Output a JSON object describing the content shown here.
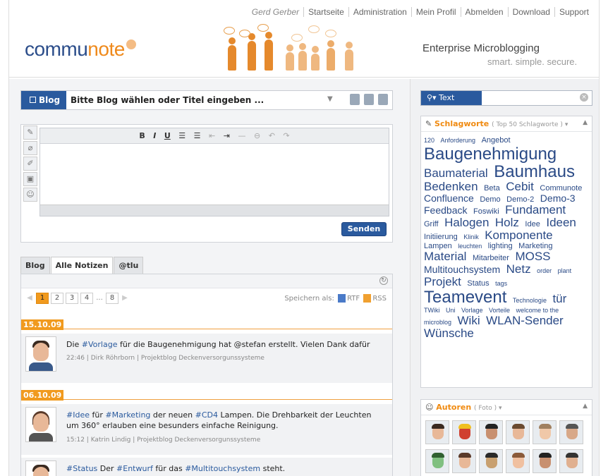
{
  "topnav": {
    "user": "Gerd Gerber",
    "links": [
      "Startseite",
      "Administration",
      "Mein Profil",
      "Abmelden",
      "Download",
      "Support"
    ]
  },
  "header": {
    "logo_a": "commu",
    "logo_b": "note",
    "tagline": "Enterprise Microblogging",
    "subtagline": "smart. simple. secure."
  },
  "composer": {
    "blog_button": "Blog",
    "blog_select": "Bitte Blog wählen oder Titel eingeben ...",
    "toolbar": [
      "B",
      "I",
      "U"
    ],
    "send_label": "Senden"
  },
  "tabs": [
    "Blog",
    "Alle Notizen",
    "@tlu"
  ],
  "pager": {
    "pages": [
      "1",
      "2",
      "3",
      "4",
      "...",
      "8"
    ],
    "save_as": "Speichern als:",
    "rtf": "RTF",
    "rss": "RSS"
  },
  "feed": [
    {
      "date": "15.10.09",
      "text_parts": [
        {
          "t": "Die "
        },
        {
          "t": "#Vorlage",
          "tag": true
        },
        {
          "t": " für die Baugenehmigung hat @stefan erstellt. Vielen Dank dafür"
        }
      ],
      "meta": "22:46 | Dirk Röhrborn | Projektblog Deckenversorgunssysteme"
    },
    {
      "date": "06.10.09",
      "text_parts": [
        {
          "t": "#Idee",
          "tag": true
        },
        {
          "t": " für "
        },
        {
          "t": "#Marketing",
          "tag": true
        },
        {
          "t": " der neuen "
        },
        {
          "t": "#CD4",
          "tag": true
        },
        {
          "t": " Lampen. Die Drehbarkeit der Leuchten um 360° erlauben eine besunders einfache Reinigung."
        }
      ],
      "meta": "15:12 | Katrin Lindig | Projektblog Deckenversorgunssysteme"
    },
    {
      "date": "",
      "text_parts": [
        {
          "t": "#Status",
          "tag": true
        },
        {
          "t": " Der "
        },
        {
          "t": "#Entwurf",
          "tag": true
        },
        {
          "t": " für das "
        },
        {
          "t": "#Multitouchsystem",
          "tag": true
        },
        {
          "t": " steht."
        }
      ],
      "meta": ""
    }
  ],
  "sidebar": {
    "search_label": "Text",
    "tags_title": "Schlagworte",
    "tags_sub": "( Top 50 Schlagworte )",
    "tags": [
      {
        "t": "120",
        "s": 1
      },
      {
        "t": "Anforderung",
        "s": 1
      },
      {
        "t": "Angebot",
        "s": 2
      },
      {
        "t": "Baugenehmigung",
        "s": 6
      },
      {
        "t": "Baumaterial",
        "s": 4
      },
      {
        "t": "Baumhaus",
        "s": 6
      },
      {
        "t": "Bedenken",
        "s": 4
      },
      {
        "t": "Beta",
        "s": 2
      },
      {
        "t": "Cebit",
        "s": 4
      },
      {
        "t": "Communote",
        "s": 2
      },
      {
        "t": "Confluence",
        "s": 3
      },
      {
        "t": "Demo",
        "s": 2
      },
      {
        "t": "Demo-2",
        "s": 2
      },
      {
        "t": "Demo-3",
        "s": 3
      },
      {
        "t": "Feedback",
        "s": 3
      },
      {
        "t": "Foswiki",
        "s": 2
      },
      {
        "t": "Fundament",
        "s": 4
      },
      {
        "t": "Griff",
        "s": 2
      },
      {
        "t": "Halogen",
        "s": 4
      },
      {
        "t": "Holz",
        "s": 4
      },
      {
        "t": "Idee",
        "s": 2
      },
      {
        "t": "Ideen",
        "s": 4
      },
      {
        "t": "Initiierung",
        "s": 2
      },
      {
        "t": "Klinik",
        "s": 1
      },
      {
        "t": "Komponente",
        "s": 4
      },
      {
        "t": "Lampen",
        "s": 2
      },
      {
        "t": "leuchten",
        "s": 1
      },
      {
        "t": "lighting",
        "s": 2
      },
      {
        "t": "Marketing",
        "s": 2
      },
      {
        "t": "Material",
        "s": 4
      },
      {
        "t": "Mitarbeiter",
        "s": 2
      },
      {
        "t": "MOSS",
        "s": 4
      },
      {
        "t": "Multitouchsystem",
        "s": 3
      },
      {
        "t": "Netz",
        "s": 4
      },
      {
        "t": "order",
        "s": 1
      },
      {
        "t": "plant",
        "s": 1
      },
      {
        "t": "Projekt",
        "s": 4
      },
      {
        "t": "Status",
        "s": 2
      },
      {
        "t": "tags",
        "s": 1
      },
      {
        "t": "Teamevent",
        "s": 6
      },
      {
        "t": "Technologie",
        "s": 1
      },
      {
        "t": "tür",
        "s": 4
      },
      {
        "t": "TWiki",
        "s": 1
      },
      {
        "t": "Uni",
        "s": 1
      },
      {
        "t": "Vorlage",
        "s": 1
      },
      {
        "t": "Vorteile",
        "s": 1
      },
      {
        "t": "welcome to the",
        "s": 1
      },
      {
        "t": "microblog",
        "s": 1
      },
      {
        "t": "Wiki",
        "s": 4
      },
      {
        "t": "WLAN-Sender",
        "s": 4
      },
      {
        "t": "Wünsche",
        "s": 4
      }
    ],
    "authors_title": "Autoren",
    "authors_sub": "( Foto )"
  }
}
